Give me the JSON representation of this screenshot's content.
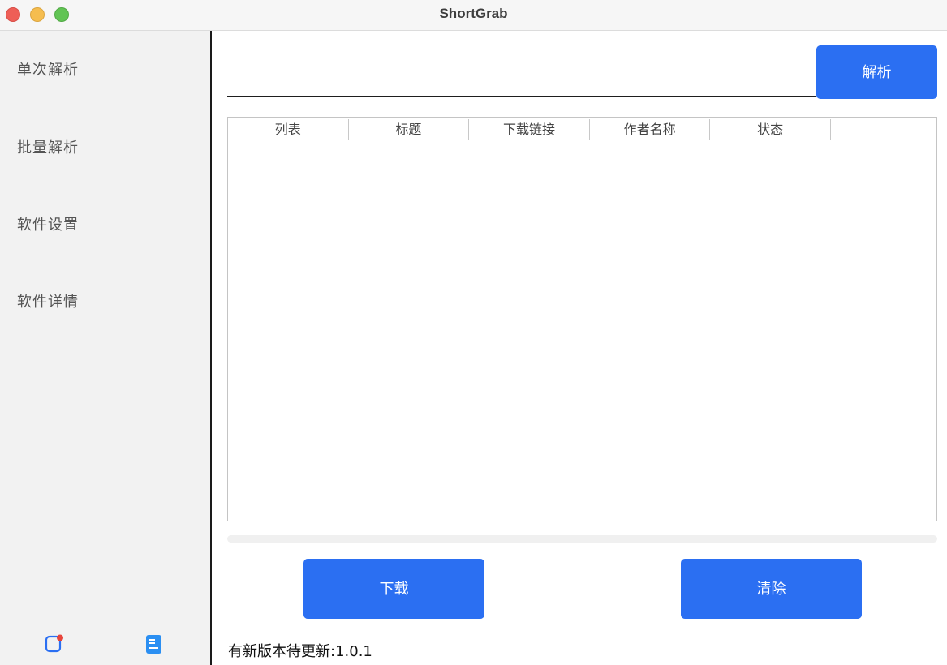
{
  "window": {
    "title": "ShortGrab"
  },
  "sidebar": {
    "items": [
      {
        "label": "单次解析"
      },
      {
        "label": "批量解析"
      },
      {
        "label": "软件设置"
      },
      {
        "label": "软件详情"
      }
    ],
    "bottom_icons": [
      "notification-icon",
      "document-icon"
    ]
  },
  "main": {
    "url_input": {
      "value": "",
      "placeholder": ""
    },
    "parse_label": "解析",
    "table": {
      "columns": [
        "列表",
        "标题",
        "下载链接",
        "作者名称",
        "状态"
      ],
      "rows": []
    },
    "download_label": "下载",
    "clear_label": "清除",
    "status_text": "有新版本待更新:1.0.1"
  },
  "colors": {
    "accent": "#2b6ff2",
    "sidebar_bg": "#f2f2f2",
    "notification_dot": "#e8453c"
  }
}
